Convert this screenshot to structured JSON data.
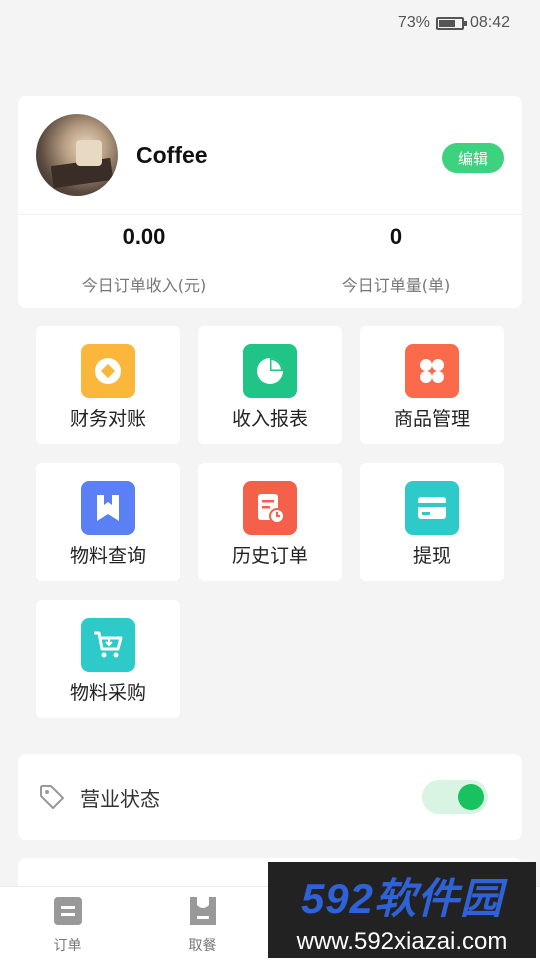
{
  "status_bar": {
    "battery": "73%",
    "time": "08:42"
  },
  "profile": {
    "name": "Coffee",
    "edit_label": "编辑",
    "stats": [
      {
        "value": "0.00",
        "label": "今日订单收入(元)"
      },
      {
        "value": "0",
        "label": "今日订单量(单)"
      }
    ]
  },
  "menu": {
    "items": [
      {
        "label": "财务对账",
        "icon": "coin-icon",
        "color": "#fbb73b"
      },
      {
        "label": "收入报表",
        "icon": "pie-chart-icon",
        "color": "#20c486"
      },
      {
        "label": "商品管理",
        "icon": "grid-icon",
        "color": "#fb6a4b"
      },
      {
        "label": "物料查询",
        "icon": "bookmark-icon",
        "color": "#5b7ff5"
      },
      {
        "label": "历史订单",
        "icon": "order-history-icon",
        "color": "#f5604b"
      },
      {
        "label": "提现",
        "icon": "card-icon",
        "color": "#2ec9c9"
      },
      {
        "label": "物料采购",
        "icon": "cart-icon",
        "color": "#2ec9c9"
      }
    ]
  },
  "business_status": {
    "label": "营业状态",
    "enabled": true,
    "accent": "#18c25e"
  },
  "tab_bar": {
    "tabs": [
      {
        "label": "订单"
      },
      {
        "label": "取餐"
      }
    ]
  },
  "watermark": {
    "brand": "592软件园",
    "url": "www.592xiazai.com"
  }
}
